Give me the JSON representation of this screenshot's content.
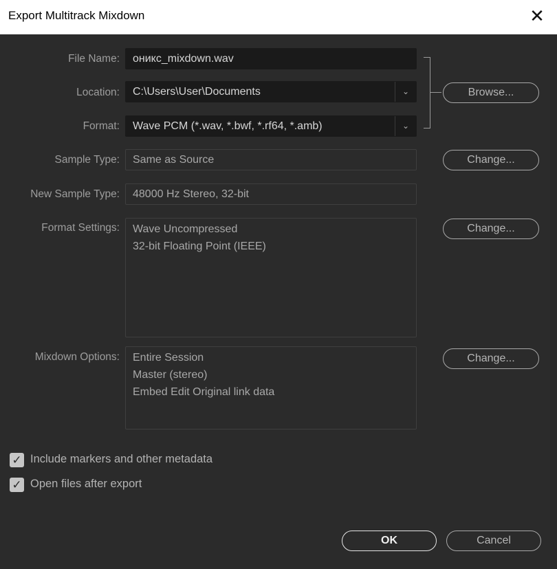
{
  "window": {
    "title": "Export Multitrack Mixdown",
    "close_icon": "close-icon"
  },
  "form": {
    "file_name": {
      "label": "File Name:",
      "value": "оникс_mixdown.wav"
    },
    "location": {
      "label": "Location:",
      "value": "C:\\Users\\User\\Documents"
    },
    "format": {
      "label": "Format:",
      "value": "Wave PCM (*.wav, *.bwf, *.rf64, *.amb)"
    },
    "sample_type": {
      "label": "Sample Type:",
      "value": "Same as Source"
    },
    "new_sample_type": {
      "label": "New Sample Type:",
      "value": "48000 Hz Stereo, 32-bit"
    },
    "format_settings": {
      "label": "Format Settings:",
      "lines": [
        "Wave Uncompressed",
        "32-bit Floating Point (IEEE)"
      ]
    },
    "mixdown_options": {
      "label": "Mixdown Options:",
      "lines": [
        "Entire Session",
        "Master (stereo)",
        "Embed Edit Original link data"
      ]
    }
  },
  "buttons": {
    "browse": "Browse...",
    "change_sample": "Change...",
    "change_format": "Change...",
    "change_mixdown": "Change...",
    "ok": "OK",
    "cancel": "Cancel"
  },
  "checkboxes": {
    "include_markers": {
      "label": "Include markers and other metadata",
      "checked": true
    },
    "open_files": {
      "label": "Open files after export",
      "checked": true
    }
  },
  "colors": {
    "background": "#2b2b2b",
    "field_dark": "#1a1a1a",
    "label": "#9d9d9d"
  }
}
